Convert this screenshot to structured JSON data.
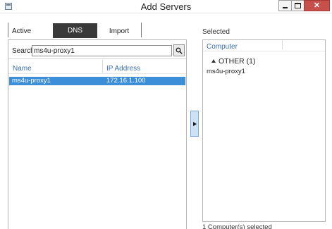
{
  "window": {
    "title": "Add Servers",
    "app_icon": "server-manager-icon",
    "controls": {
      "minimize_icon": "minimize-icon",
      "maximize_icon": "maximize-icon",
      "close_icon": "close-icon",
      "close_glyph": "✕"
    }
  },
  "tabs": [
    {
      "label": "Active Directory",
      "selected": false
    },
    {
      "label": "DNS",
      "selected": true
    },
    {
      "label": "Import",
      "selected": false
    }
  ],
  "search": {
    "label": "Search:",
    "value": "ms4u-proxy1",
    "button_icon": "search-icon"
  },
  "results": {
    "columns": [
      "Name",
      "IP Address"
    ],
    "rows": [
      {
        "name": "ms4u-proxy1",
        "ip": "172.16.1.100",
        "selected": true
      }
    ]
  },
  "add_button_icon": "right-arrow-icon",
  "selected": {
    "label": "Selected",
    "column": "Computer",
    "groups": [
      {
        "label": "OTHER (1)",
        "items": [
          "ms4u-proxy1"
        ]
      }
    ],
    "count_text": "1 Computer(s) selected"
  },
  "colors": {
    "accent": "#3d8ed8",
    "tab_active": "#3a3a3a",
    "close_button": "#c7504b",
    "header_text": "#3b6fa8"
  }
}
